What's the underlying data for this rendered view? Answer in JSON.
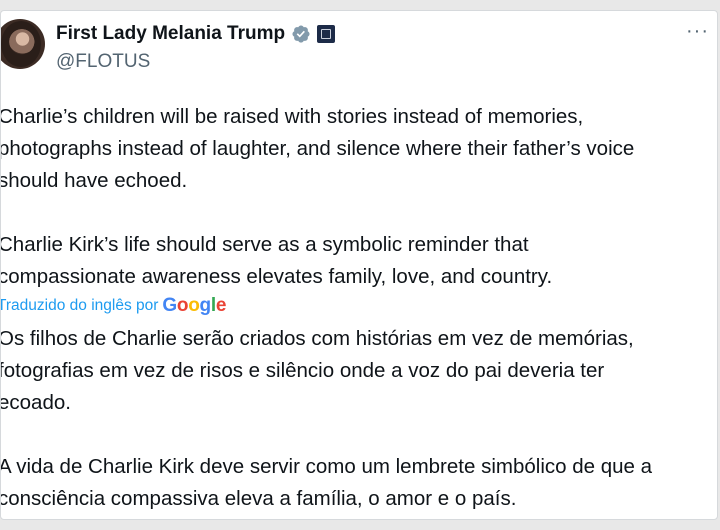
{
  "author": {
    "display_name": "First Lady Melania Trump",
    "handle": "@FLOTUS",
    "verified_icon": "verified-badge-gray",
    "affiliate_icon": "government-affiliation-badge"
  },
  "post": {
    "text": "Charlie’s children will be raised with stories instead of memories,\nphotographs instead of laughter, and silence where their father’s voice\nshould have echoed.\n\nCharlie Kirk’s life should serve as a symbolic reminder that\ncompassionate awareness elevates family, love, and country."
  },
  "translation": {
    "label": "Traduzido do inglês por",
    "provider": [
      "G",
      "o",
      "o",
      "g",
      "l",
      "e"
    ],
    "provider_colors": [
      "#4285F4",
      "#EA4335",
      "#FBBC05",
      "#4285F4",
      "#34A853",
      "#EA4335"
    ],
    "text": "Os filhos de Charlie serão criados com histórias em vez de memórias,\nfotografias em vez de risos e silêncio onde a voz do pai deveria ter\necoado.\n\nA vida de Charlie Kirk deve servir como um lembrete simbólico de que a\nconsciência compassiva eleva a família, o amor e o país."
  },
  "colors": {
    "accent": "#1d9bf0",
    "text": "#0f1419",
    "secondary": "#536471"
  },
  "menu": {
    "more_glyph": "···"
  }
}
